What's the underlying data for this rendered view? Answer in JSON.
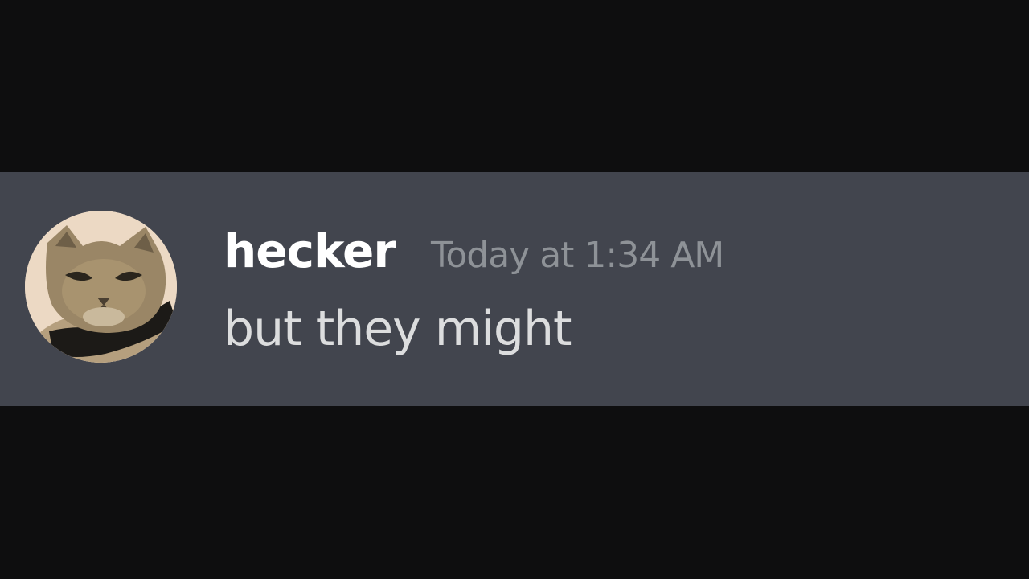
{
  "message": {
    "author": "hecker",
    "timestamp": "Today at 1:34 AM",
    "content": "but they might",
    "avatar_icon": "cat-avatar"
  },
  "colors": {
    "background": "#0e0e0f",
    "message_highlight": "#42454e",
    "username": "#ffffff",
    "timestamp": "#8e9297",
    "content": "#dcddde"
  }
}
